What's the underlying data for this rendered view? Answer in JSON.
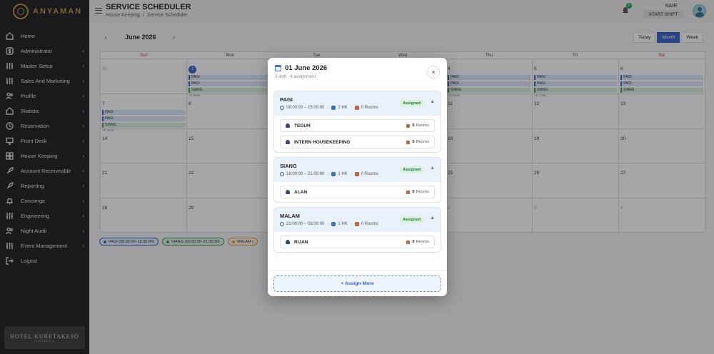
{
  "brand": {
    "name": "ANYAMAN",
    "hotel_name": "HOTEL KURETAKESO",
    "hotel_sub": "INDONESIA"
  },
  "sidebar": {
    "items": [
      {
        "label": "Home",
        "icon": "home-icon",
        "chevron": false
      },
      {
        "label": "Administrator",
        "icon": "dollar-icon",
        "chevron": true
      },
      {
        "label": "Master Setup",
        "icon": "sliders-icon",
        "chevron": true
      },
      {
        "label": "Sales And Marketing",
        "icon": "sliders-icon",
        "chevron": true
      },
      {
        "label": "Profile",
        "icon": "users-icon",
        "chevron": true
      },
      {
        "label": "Statistic",
        "icon": "home-icon",
        "chevron": true
      },
      {
        "label": "Reservation",
        "icon": "clock-icon",
        "chevron": true
      },
      {
        "label": "Front Desk",
        "icon": "monitor-icon",
        "chevron": true
      },
      {
        "label": "House Keeping",
        "icon": "grid-icon",
        "chevron": true
      },
      {
        "label": "Account Receiveable",
        "icon": "rocket-icon",
        "chevron": true
      },
      {
        "label": "Reporting",
        "icon": "rocket-icon",
        "chevron": true
      },
      {
        "label": "Concierge",
        "icon": "bell-icon",
        "chevron": true
      },
      {
        "label": "Engineering",
        "icon": "sliders-icon",
        "chevron": true
      },
      {
        "label": "Night Audit",
        "icon": "users-icon",
        "chevron": true
      },
      {
        "label": "Event Management",
        "icon": "sliders-icon",
        "chevron": true
      },
      {
        "label": "Logout",
        "icon": "logout-icon",
        "chevron": false
      }
    ]
  },
  "header": {
    "title": "SERVICE SCHEDULER",
    "breadcrumb": [
      "House Keeping",
      "/",
      "Service Scheduler"
    ],
    "notification_count": "0",
    "user_name": "NAIR",
    "shift_button": "START SHIFT"
  },
  "calendar": {
    "prev": "‹",
    "next": "›",
    "month_label": "June 2026",
    "views": [
      "Today",
      "Month",
      "Week"
    ],
    "active_view": "Month",
    "weekdays": [
      "Sun",
      "Mon",
      "Tue",
      "Wed",
      "Thu",
      "Fri",
      "Sat"
    ],
    "weeks": [
      [
        {
          "d": "31",
          "muted": true
        },
        {
          "d": "1",
          "today": true,
          "events": [
            "PAGI",
            "PAGI",
            "SIANG"
          ],
          "more": "+1 more"
        },
        {
          "d": "2"
        },
        {
          "d": "3"
        },
        {
          "d": "4",
          "events": [
            "PAGI",
            "PAGI",
            "SIANG"
          ],
          "more": "+1 more"
        },
        {
          "d": "5",
          "events": [
            "PAGI",
            "PAGI",
            "SIANG"
          ],
          "more": "+1 more"
        },
        {
          "d": "6",
          "events": [
            "PAGI",
            "PAGI",
            "SIANG"
          ]
        }
      ],
      [
        {
          "d": "7",
          "events": [
            "PAGI",
            "PAGI",
            "SIANG"
          ],
          "more": "+1 more"
        },
        {
          "d": "8"
        },
        {
          "d": "9"
        },
        {
          "d": "10"
        },
        {
          "d": "11"
        },
        {
          "d": "12"
        },
        {
          "d": "13"
        }
      ],
      [
        {
          "d": "14"
        },
        {
          "d": "15"
        },
        {
          "d": "16"
        },
        {
          "d": "17"
        },
        {
          "d": "18"
        },
        {
          "d": "19"
        },
        {
          "d": "20"
        }
      ],
      [
        {
          "d": "21"
        },
        {
          "d": "22"
        },
        {
          "d": "23"
        },
        {
          "d": "24"
        },
        {
          "d": "25"
        },
        {
          "d": "26"
        },
        {
          "d": "27"
        }
      ],
      [
        {
          "d": "28"
        },
        {
          "d": "29"
        },
        {
          "d": "30"
        },
        {
          "d": "1",
          "muted": true
        },
        {
          "d": "2",
          "muted": true
        },
        {
          "d": "3",
          "muted": true
        },
        {
          "d": "4",
          "muted": true
        }
      ]
    ],
    "legend": [
      {
        "label": "PAGI (08:00:00–15:00:00)",
        "cls": "pagi"
      },
      {
        "label": "SIANG (16:00:00–21:00:00)",
        "cls": "siang"
      },
      {
        "label": "MALAM (",
        "cls": "malam"
      }
    ]
  },
  "modal": {
    "title": "01 June 2026",
    "subtitle": "3 shift · 4 assignment",
    "close": "×",
    "shifts": [
      {
        "name": "PAGI",
        "time": "08:00:00 – 15:00:00",
        "hk": "2 HK",
        "rooms": "0 Rooms",
        "status": "Assigned",
        "staff": [
          {
            "name": "TEGUH",
            "rooms_num": "0",
            "rooms_label": "Rooms"
          },
          {
            "name": "INTERN HOUSEKEEPING",
            "rooms_num": "0",
            "rooms_label": "Rooms"
          }
        ]
      },
      {
        "name": "SIANG",
        "time": "16:00:00 – 21:00:00",
        "hk": "1 HK",
        "rooms": "0 Rooms",
        "status": "Assigned",
        "staff": [
          {
            "name": "ALAN",
            "rooms_num": "0",
            "rooms_label": "Rooms"
          }
        ]
      },
      {
        "name": "MALAM",
        "time": "22:00:00 – 05:00:00",
        "hk": "1 HK",
        "rooms": "0 Rooms",
        "status": "Assigned",
        "staff": [
          {
            "name": "RIJAN",
            "rooms_num": "0",
            "rooms_label": "Rooms"
          }
        ]
      }
    ],
    "assign_more": "+ Assign More"
  },
  "colors": {
    "primary": "#3663c6",
    "pagi": "#3663c6",
    "siang": "#3a9a4b",
    "malam": "#e39a3a",
    "assigned_bg": "#d9f2de",
    "assigned_text": "#1f7a35",
    "sidebar_bg": "#1e1e1e",
    "gold": "#b8953f"
  }
}
